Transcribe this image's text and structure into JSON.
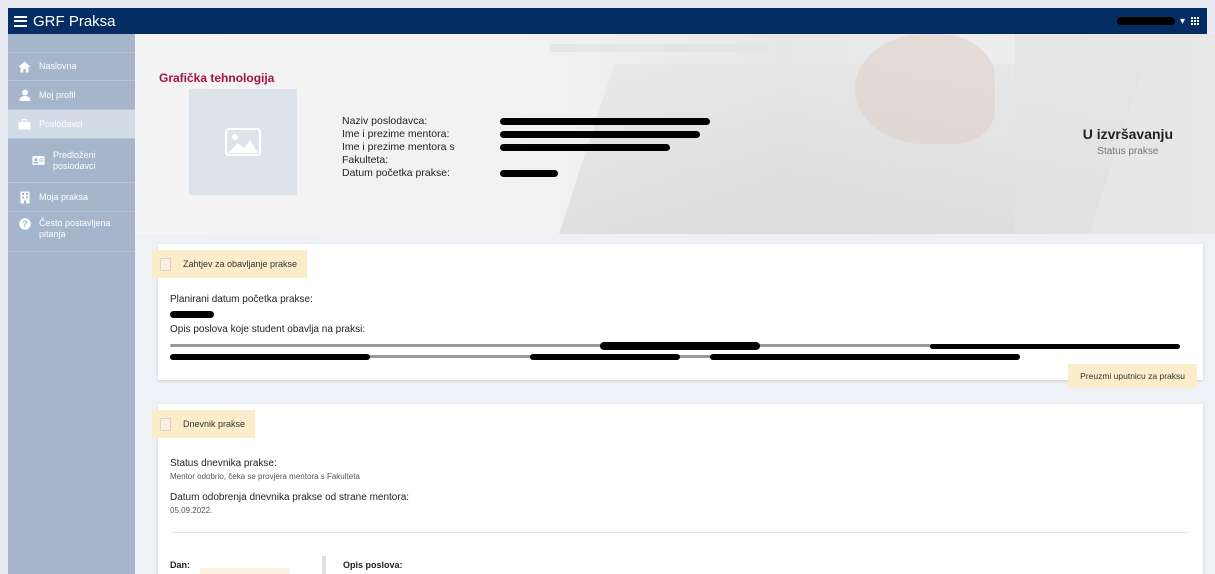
{
  "app": {
    "title": "GRF Praksa"
  },
  "sidebar": {
    "items": [
      {
        "label": "Naslovna",
        "icon": "home-icon"
      },
      {
        "label": "Moj profil",
        "icon": "user-icon"
      },
      {
        "label": "Poslodavci",
        "icon": "briefcase-icon"
      },
      {
        "label": "Predloženi poslodavci",
        "icon": "id-card-icon"
      },
      {
        "label": "Moja praksa",
        "icon": "building-icon"
      },
      {
        "label": "Često postavljena pitanja",
        "icon": "question-icon"
      }
    ]
  },
  "hero": {
    "title": "Grafička tehnologija",
    "fields": [
      {
        "label": "Naziv poslodavca:"
      },
      {
        "label": "Ime i prezime mentora:"
      },
      {
        "label": "Ime i prezime mentora s Fakulteta:"
      },
      {
        "label": "Datum početka prakse:"
      }
    ],
    "status_value": "U izvršavanju",
    "status_label": "Status prakse"
  },
  "request_card": {
    "badge": "Zahtjev za obavljanje prakse",
    "planned_label": "Planirani datum početka prakse:",
    "description_label": "Opis poslova koje student obavlja na praksi:",
    "download_button": "Preuzmi uputnicu za praksu"
  },
  "diary_card": {
    "badge": "Dnevnik prakse",
    "status_label": "Status dnevnika prakse:",
    "status_value": "Mentor odobrio, čeka se provjera mentora s Fakulteta",
    "approval_label": "Datum odobrenja dnevnika prakse od strane mentora:",
    "approval_value": "05.09.2022.",
    "day_label": "Dan:",
    "work_label": "Opis poslova:"
  }
}
